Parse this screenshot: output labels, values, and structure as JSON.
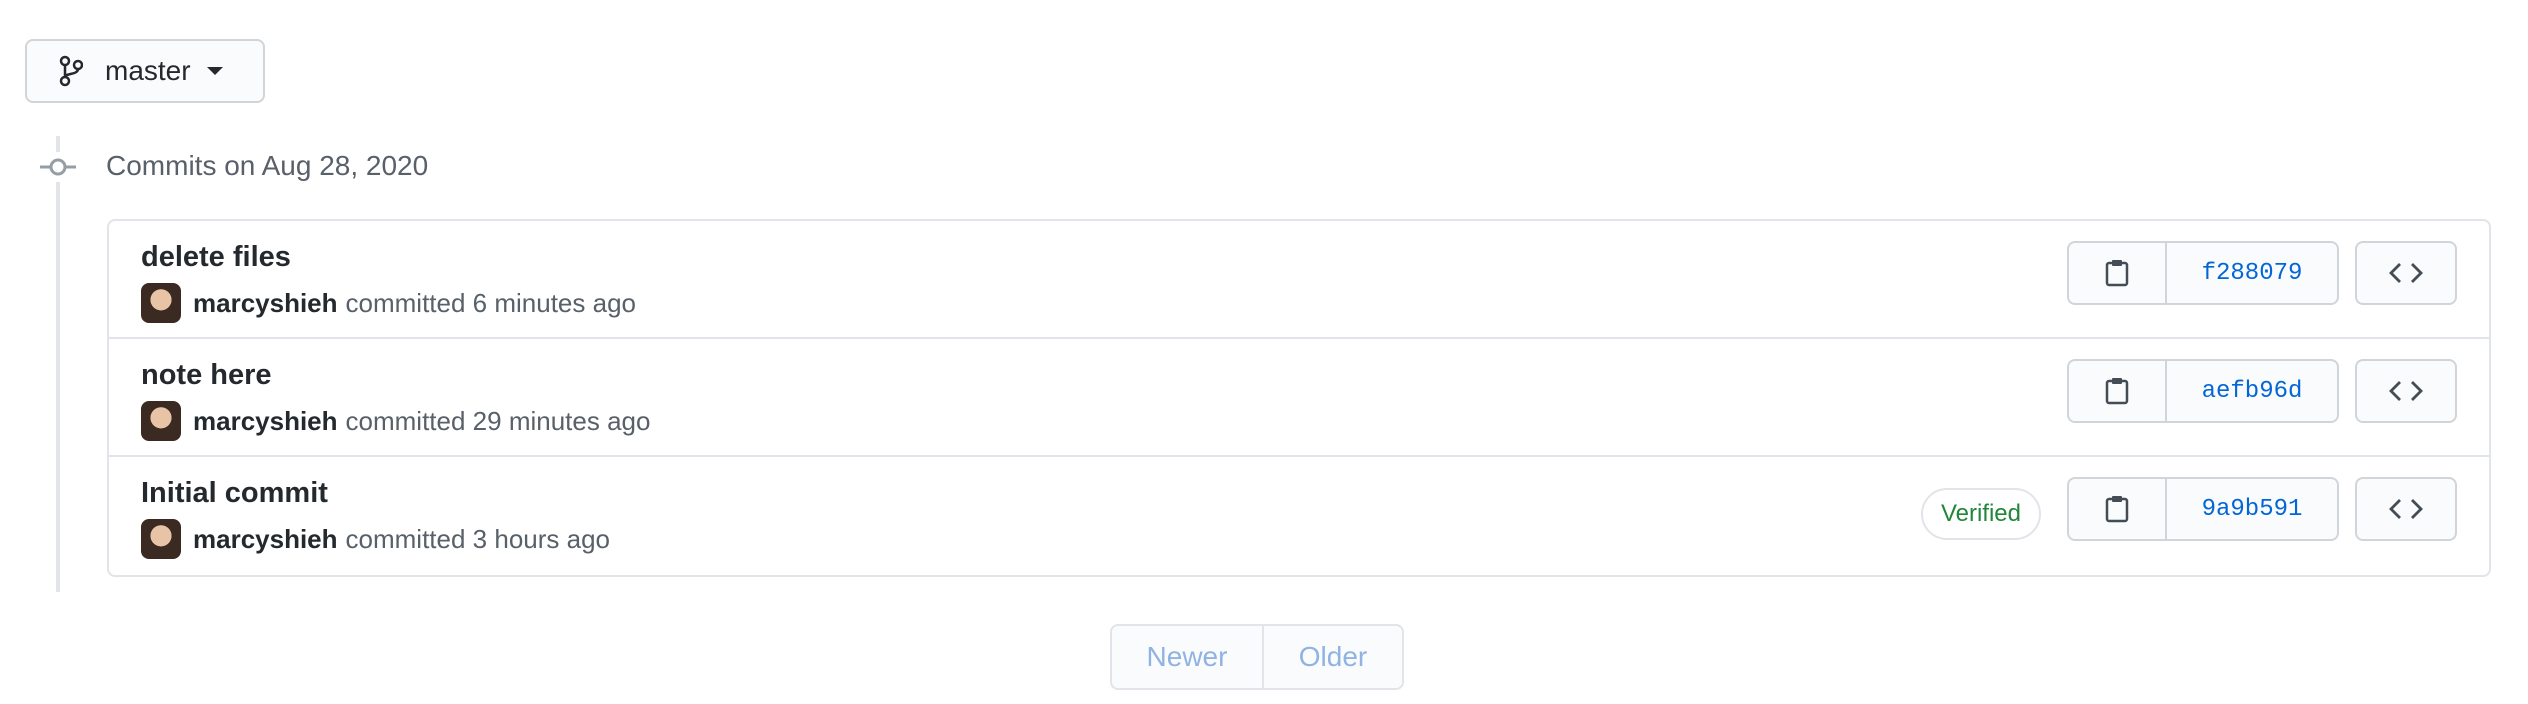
{
  "branch": {
    "name": "master",
    "icon": "git-branch-icon"
  },
  "timeline": {
    "title": "Commits on Aug 28, 2020"
  },
  "commits": [
    {
      "title": "delete files",
      "author": "marcyshieh",
      "time": "committed 6 minutes ago",
      "sha": "f288079",
      "verified": ""
    },
    {
      "title": "note here",
      "author": "marcyshieh",
      "time": "committed 29 minutes ago",
      "sha": "aefb96d",
      "verified": ""
    },
    {
      "title": "Initial commit",
      "author": "marcyshieh",
      "time": "committed 3 hours ago",
      "sha": "9a9b591",
      "verified": "Verified"
    }
  ],
  "pagination": {
    "newer": "Newer",
    "older": "Older"
  },
  "colors": {
    "accent": "#0366d6",
    "verified": "#22863a",
    "border": "#e1e4e8"
  }
}
